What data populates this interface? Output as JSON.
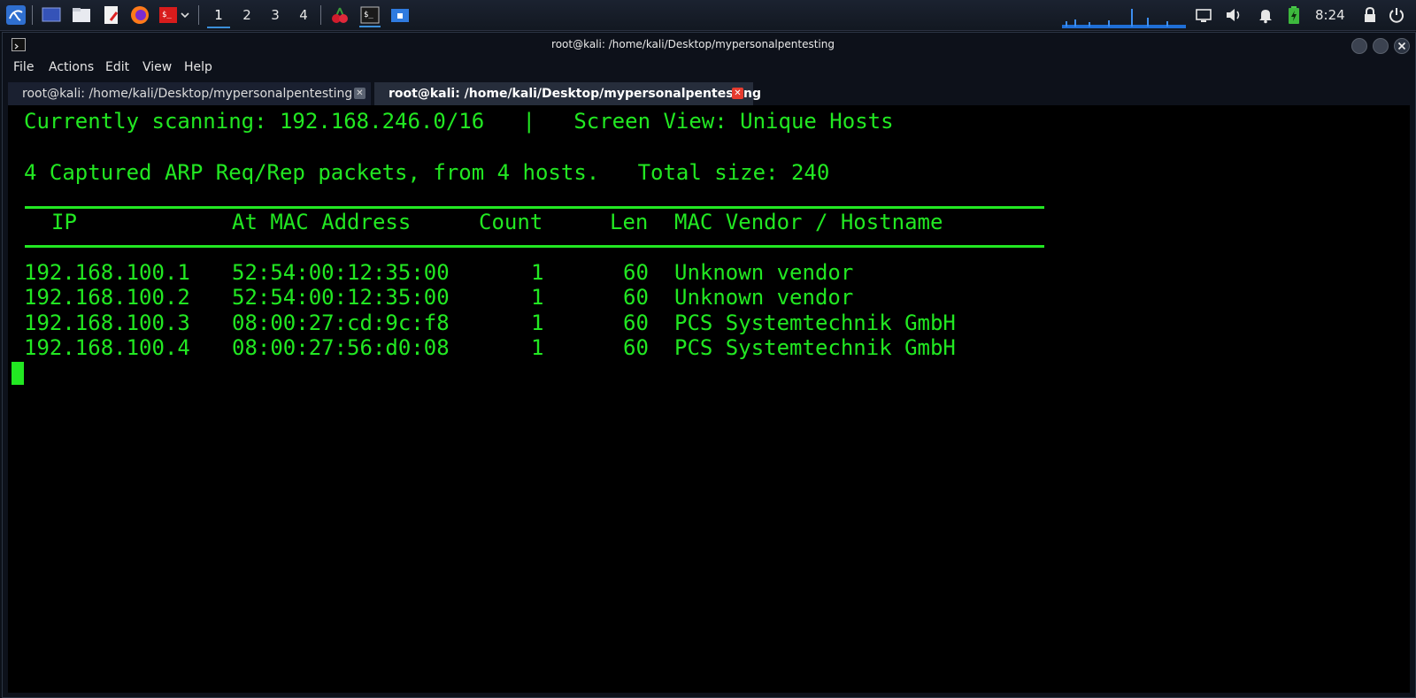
{
  "taskbar": {
    "workspaces": [
      "1",
      "2",
      "3",
      "4"
    ],
    "clock": "8:24",
    "icons": [
      "kali-menu-icon",
      "desktop-icon",
      "files-icon",
      "text-editor-icon",
      "firefox-icon",
      "terminal-red-icon",
      "chevron-down-icon",
      "cherrytree-icon",
      "terminal-icon",
      "window-icon",
      "network-graph-icon",
      "display-icon",
      "volume-icon",
      "bell-icon",
      "battery-icon",
      "lock-icon",
      "power-icon"
    ]
  },
  "window": {
    "title": "root@kali: /home/kali/Desktop/mypersonalpentesting",
    "menu": [
      "File",
      "Actions",
      "Edit",
      "View",
      "Help"
    ],
    "tabs": [
      {
        "label": "root@kali: /home/kali/Desktop/mypersonalpentesting",
        "active": false
      },
      {
        "label": "root@kali: /home/kali/Desktop/mypersonalpentesting",
        "active": true
      }
    ]
  },
  "terminal": {
    "scan_line": "Currently scanning: 192.168.246.0/16   |   Screen View: Unique Hosts",
    "summary_line": "4 Captured ARP Req/Rep packets, from 4 hosts.   Total size: 240",
    "headers": {
      "ip": "IP",
      "mac": "At MAC Address",
      "count": "Count",
      "len": "Len",
      "vendor": "MAC Vendor / Hostname"
    },
    "rows": [
      {
        "ip": "192.168.100.1",
        "mac": "52:54:00:12:35:00",
        "count": "1",
        "len": "60",
        "vendor": "Unknown vendor"
      },
      {
        "ip": "192.168.100.2",
        "mac": "52:54:00:12:35:00",
        "count": "1",
        "len": "60",
        "vendor": "Unknown vendor"
      },
      {
        "ip": "192.168.100.3",
        "mac": "08:00:27:cd:9c:f8",
        "count": "1",
        "len": "60",
        "vendor": "PCS Systemtechnik GmbH"
      },
      {
        "ip": "192.168.100.4",
        "mac": "08:00:27:56:d0:08",
        "count": "1",
        "len": "60",
        "vendor": "PCS Systemtechnik GmbH"
      }
    ],
    "text_color": "#22e822"
  }
}
